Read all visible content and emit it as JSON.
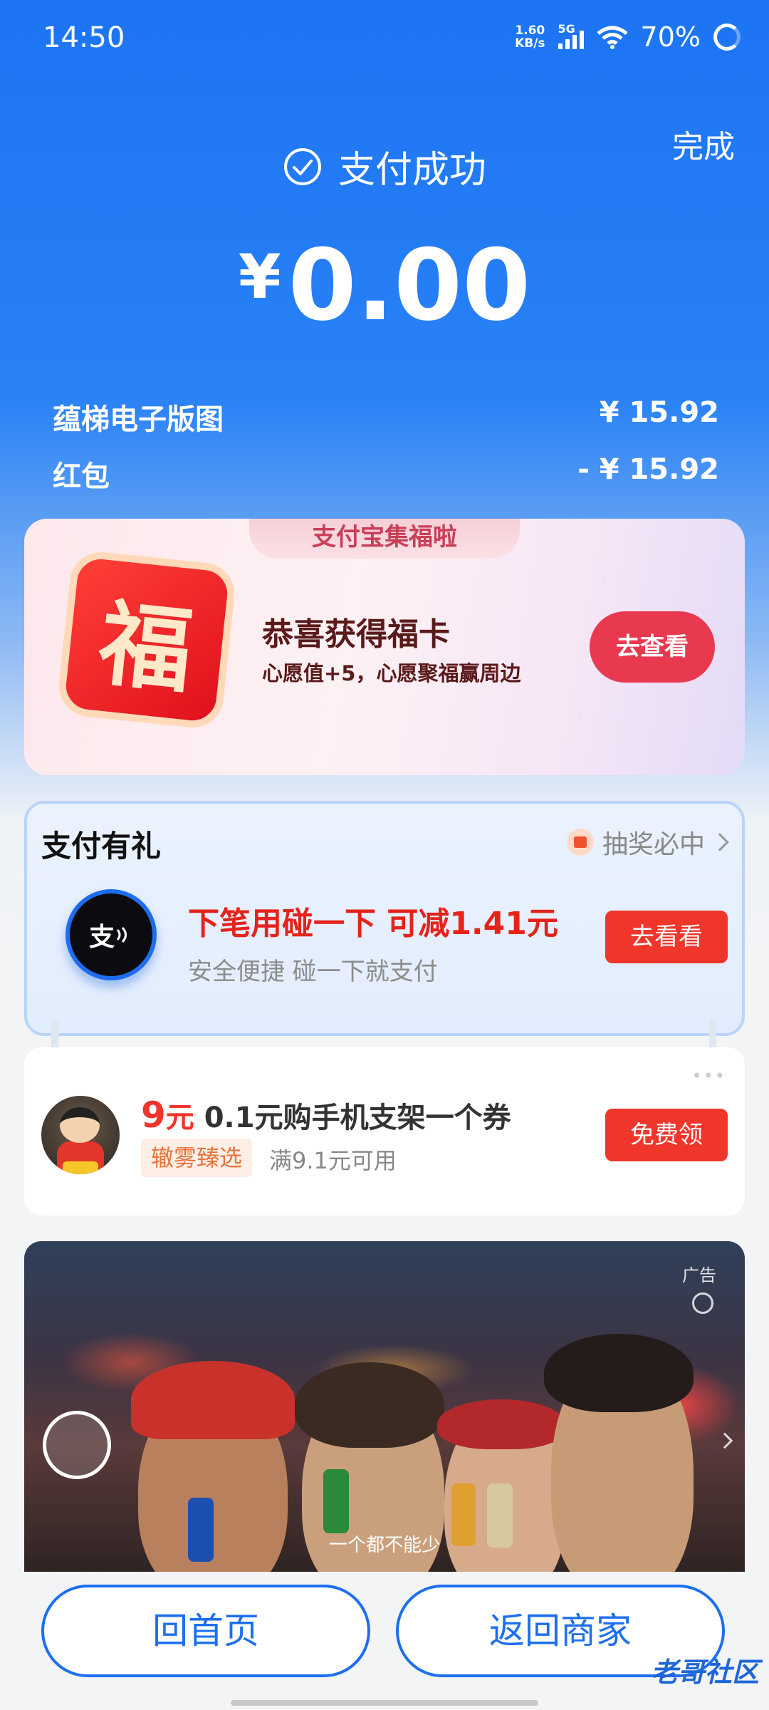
{
  "status_bar": {
    "time": "14:50",
    "net_speed_value": "1.60",
    "net_speed_unit": "KB/s",
    "network": "5G",
    "battery": "70%"
  },
  "header": {
    "done_label": "完成",
    "success_label": "支付成功",
    "currency": "¥",
    "amount": "0.00"
  },
  "line_items": [
    {
      "label": "蕴梯电子版图",
      "value": "¥ 15.92"
    },
    {
      "label": "红包",
      "value": "- ¥ 15.92"
    }
  ],
  "fu_card": {
    "tab": "支付宝集福啦",
    "icon_char": "福",
    "title": "恭喜获得福卡",
    "subtitle": "心愿值+5，心愿聚福赢周边",
    "button": "去查看"
  },
  "gift_card": {
    "title": "支付有礼",
    "lottery": "抽奖必中",
    "logo_text": "支",
    "main": "下笔用碰一下 可减1.41元",
    "sub": "安全便捷 碰一下就支付",
    "button": "去看看"
  },
  "coupon_card": {
    "more": "•••",
    "price_num": "9",
    "price_unit": "元",
    "title": " 0.1元购手机支架一个券",
    "tag": "辙雾臻选",
    "condition": "满9.1元可用",
    "button": "免费领"
  },
  "ad": {
    "label": "广告",
    "subtitle": "一个都不能少"
  },
  "bottom": {
    "home_button": "回首页",
    "back_button": "返回商家",
    "watermark": "老哥社区"
  },
  "colors": {
    "brand_blue": "#1c74f4",
    "accent_red": "#f0352a",
    "fu_red": "#e8394f"
  }
}
